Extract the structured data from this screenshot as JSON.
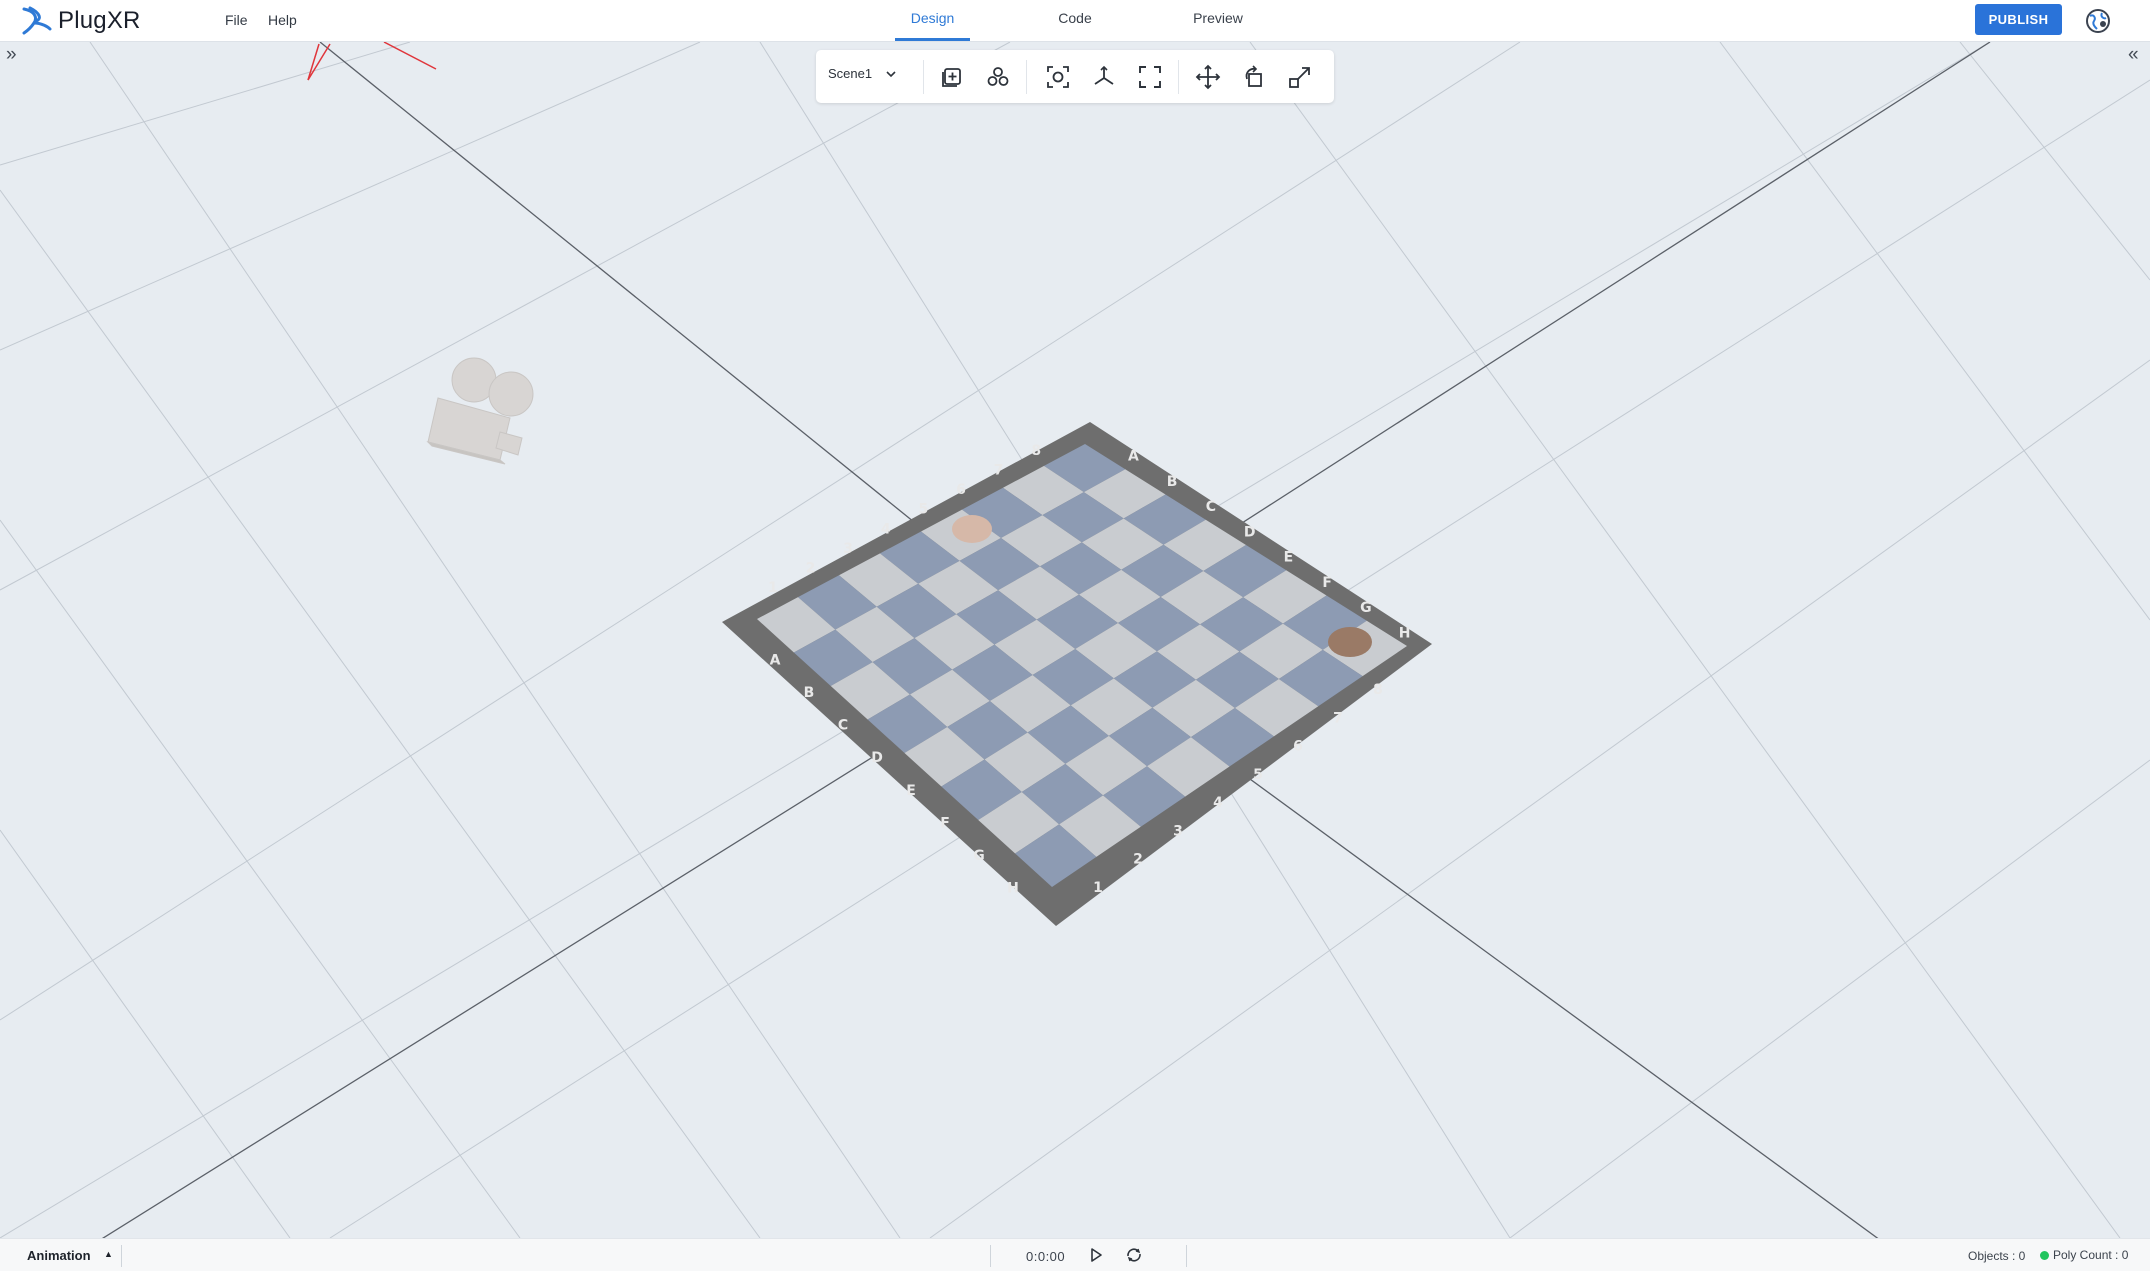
{
  "app": {
    "name": "PlugXR"
  },
  "menu": {
    "file": "File",
    "help": "Help"
  },
  "tabs": [
    "Design",
    "Code",
    "Preview"
  ],
  "active_tab": "Design",
  "header": {
    "publish_label": "PUBLISH"
  },
  "toolbar": {
    "scene_select": "Scene1",
    "buttons": [
      {
        "name": "add-object-icon"
      },
      {
        "name": "group-icon"
      },
      {
        "name": "focus-icon"
      },
      {
        "name": "axes-icon"
      },
      {
        "name": "fullscreen-icon"
      },
      {
        "name": "move-icon"
      },
      {
        "name": "rotate-icon"
      },
      {
        "name": "scale-icon"
      }
    ]
  },
  "chessboard": {
    "files": [
      "A",
      "B",
      "C",
      "D",
      "E",
      "F",
      "G",
      "H"
    ],
    "ranks": [
      "1",
      "2",
      "3",
      "4",
      "5",
      "6",
      "7",
      "8"
    ]
  },
  "animation": {
    "label": "Animation",
    "time": "0:0:00"
  },
  "status": {
    "objects": "Objects : 0",
    "poly_count": "Poly Count : 0"
  },
  "colors": {
    "accent": "#2a73d9",
    "viewport_bg": "#e7ecf1",
    "board_frame": "#6e6e6e",
    "board_dark": "#8d9bb3",
    "board_light": "#c9ccd0"
  }
}
